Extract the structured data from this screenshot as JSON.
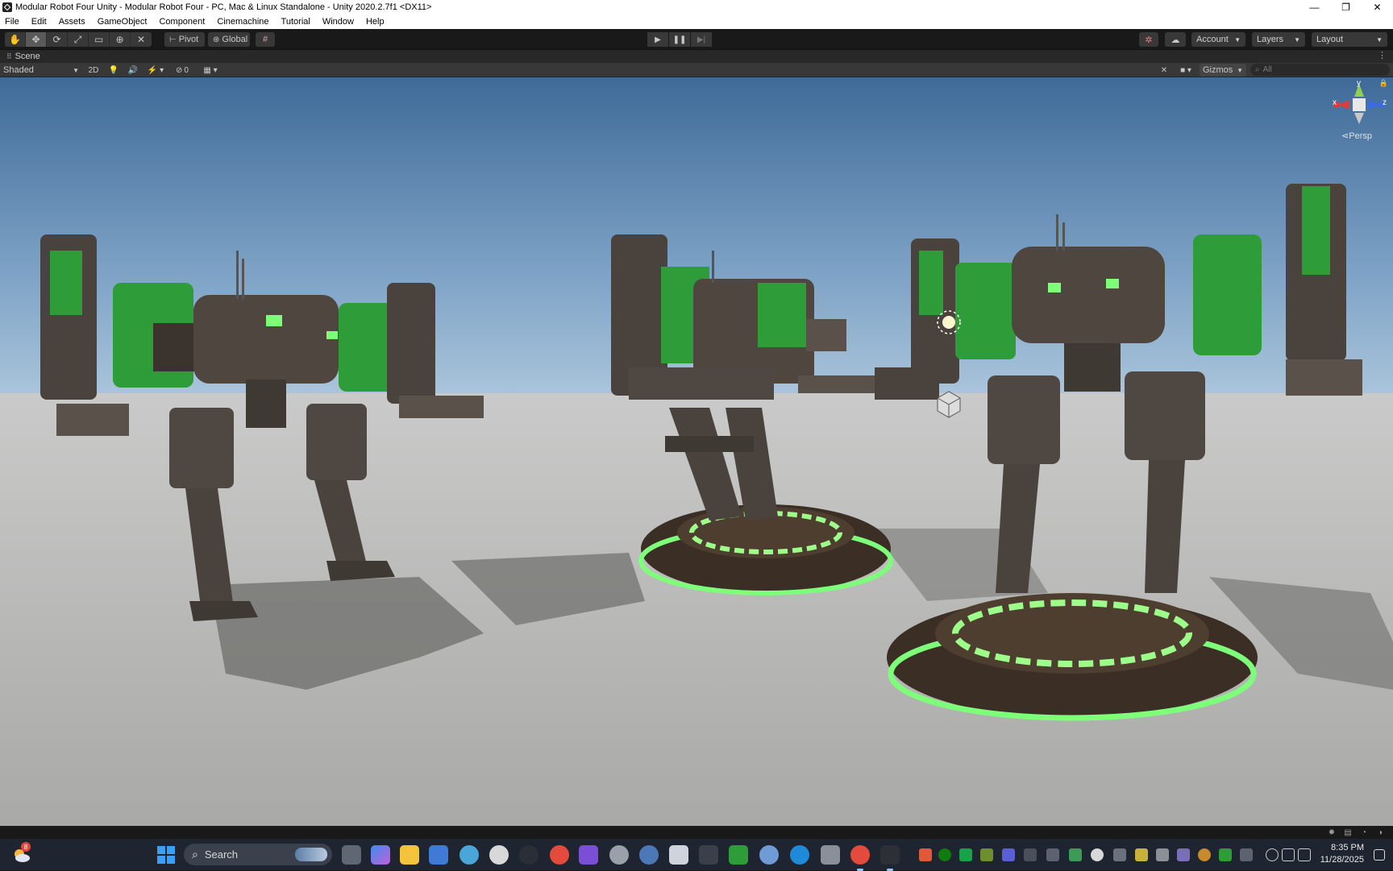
{
  "titlebar": {
    "title": "Modular Robot Four Unity - Modular Robot Four - PC, Mac & Linux Standalone - Unity 2020.2.7f1 <DX11>",
    "minimize": "—",
    "maximize": "❐",
    "close": "✕"
  },
  "menu": [
    "File",
    "Edit",
    "Assets",
    "GameObject",
    "Component",
    "Cinemachine",
    "Tutorial",
    "Window",
    "Help"
  ],
  "toolbar": {
    "pivot_label": "Pivot",
    "global_label": "Global",
    "account_label": "Account",
    "layers_label": "Layers",
    "layout_label": "Layout"
  },
  "scene": {
    "tab_label": "Scene",
    "shading_mode": "Shaded",
    "mode_2d": "2D",
    "hidden_count": "0",
    "gizmos_label": "Gizmos",
    "search_placeholder": "All",
    "projection_label": "Persp",
    "axis_x": "x",
    "axis_y": "y",
    "axis_z": "z"
  },
  "taskbar": {
    "search_label": "Search",
    "notification_count": "8",
    "time": "8:35 PM",
    "date": "11/28/2025"
  },
  "colors": {
    "editor_bg": "#191919",
    "toolbar_button": "#383838",
    "sky_top": "#3e6a9a",
    "sky_horizon": "#a3c0d8",
    "ground": "#b9b9b7",
    "robot_green": "#2f9c3a",
    "robot_body": "#4a433d",
    "glow_green": "#7dff7a"
  }
}
